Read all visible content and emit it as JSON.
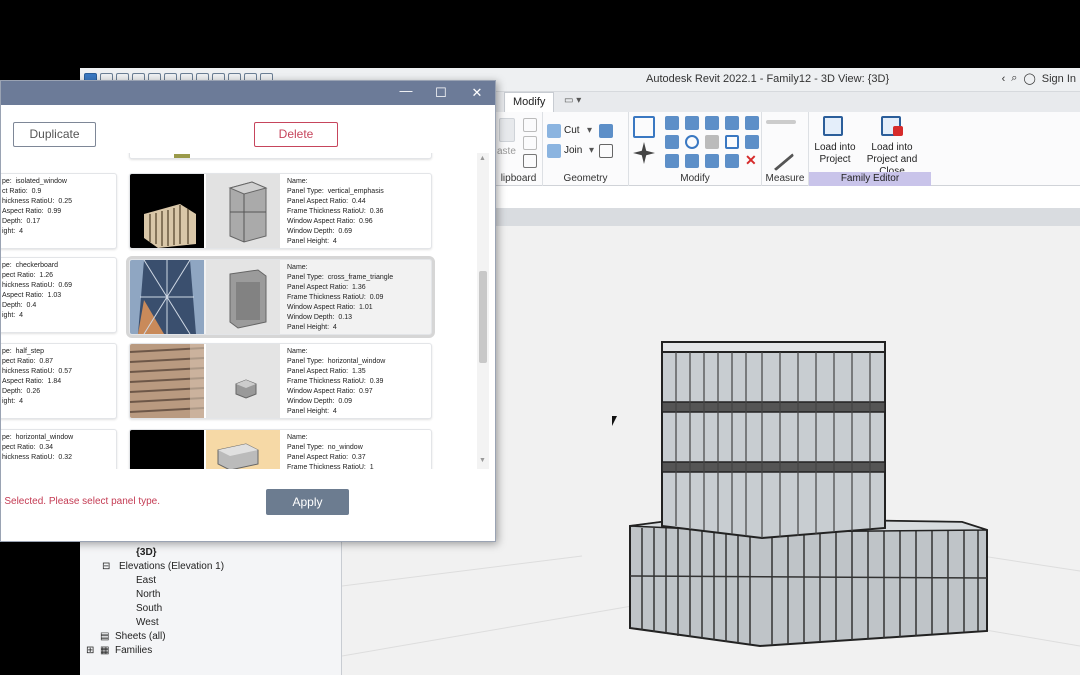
{
  "revit": {
    "window_title": "Autodesk Revit 2022.1 - Family12 - 3D View: {3D}",
    "signin_label": "Sign In",
    "active_tab": "Modify",
    "ribbon": {
      "cut_label": "Cut",
      "join_label": "Join",
      "clipboard_label": "lipboard",
      "paste_label": "aste",
      "geometry_label": "Geometry",
      "modify_label": "Modify",
      "measure_label": "Measure",
      "family_editor_label": "Family Editor",
      "load_into_project": "Load into\nProject",
      "load_into_project_close": "Load into\nProject and Close"
    }
  },
  "project_browser": {
    "items": [
      "{3D}",
      "Elevations (Elevation 1)",
      "East",
      "North",
      "South",
      "West",
      "Sheets (all)",
      "Families"
    ]
  },
  "dialog": {
    "duplicate_label": "Duplicate",
    "delete_label": "Delete",
    "apply_label": "Apply",
    "status_message": "ce is Selected. Please select panel type.",
    "left_panels": [
      "pe:  isolated_window\nct Ratio:  0.9\nhickness RatioU:  0.25\nAspect Ratio:  0.99\nDepth:  0.17\night:  4",
      "pe:  checkerboard\npect Ratio:  1.26\nhickness RatioU:  0.69\nAspect Ratio:  1.03\nDepth:  0.4\night:  4",
      "pe:  half_step\npect Ratio:  0.87\nhickness RatioU:  0.57\nAspect Ratio:  1.84\nDepth:  0.26\night:  4",
      "pe:  horizontal_window\npect Ratio:  0.34\nhickness RatioU:  0.32"
    ],
    "right_panels": [
      "Name:\nPanel Type:  vertical_emphasis\nPanel Aspect Ratio:  0.44\nFrame Thickness RatioU:  0.36\nWindow Aspect Ratio:  0.96\nWindow Depth:  0.69\nPanel Height:  4",
      "Name:\nPanel Type:  cross_frame_triangle\nPanel Aspect Ratio:  1.36\nFrame Thickness RatioU:  0.09\nWindow Aspect Ratio:  1.01\nWindow Depth:  0.13\nPanel Height:  4",
      "Name:\nPanel Type:  horizontal_window\nPanel Aspect Ratio:  1.35\nFrame Thickness RatioU:  0.39\nWindow Aspect Ratio:  0.97\nWindow Depth:  0.09\nPanel Height:  4",
      "Name:\nPanel Type:  no_window\nPanel Aspect Ratio:  0.37\nFrame Thickness RatioU:  1"
    ]
  }
}
